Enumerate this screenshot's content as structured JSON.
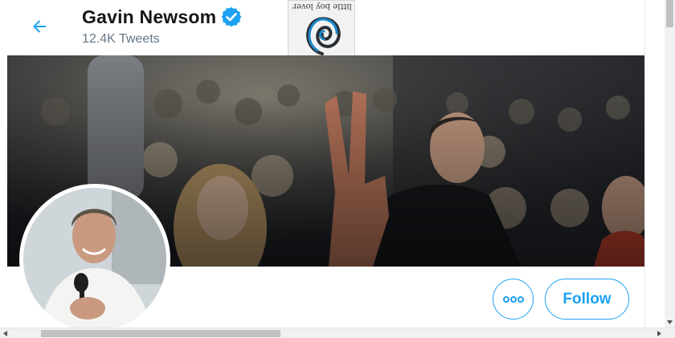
{
  "header": {
    "profile_name": "Gavin Newsom",
    "tweet_count": "12.4K Tweets",
    "verified": true,
    "back_icon": "arrow-left-icon",
    "verified_icon": "verified-badge-icon"
  },
  "sticker": {
    "caption": "little boy lover"
  },
  "actions": {
    "more_icon": "ellipsis-icon",
    "follow_label": "Follow"
  },
  "colors": {
    "accent": "#1da1f2",
    "name_text": "#14171a",
    "secondary_text": "#657786"
  }
}
